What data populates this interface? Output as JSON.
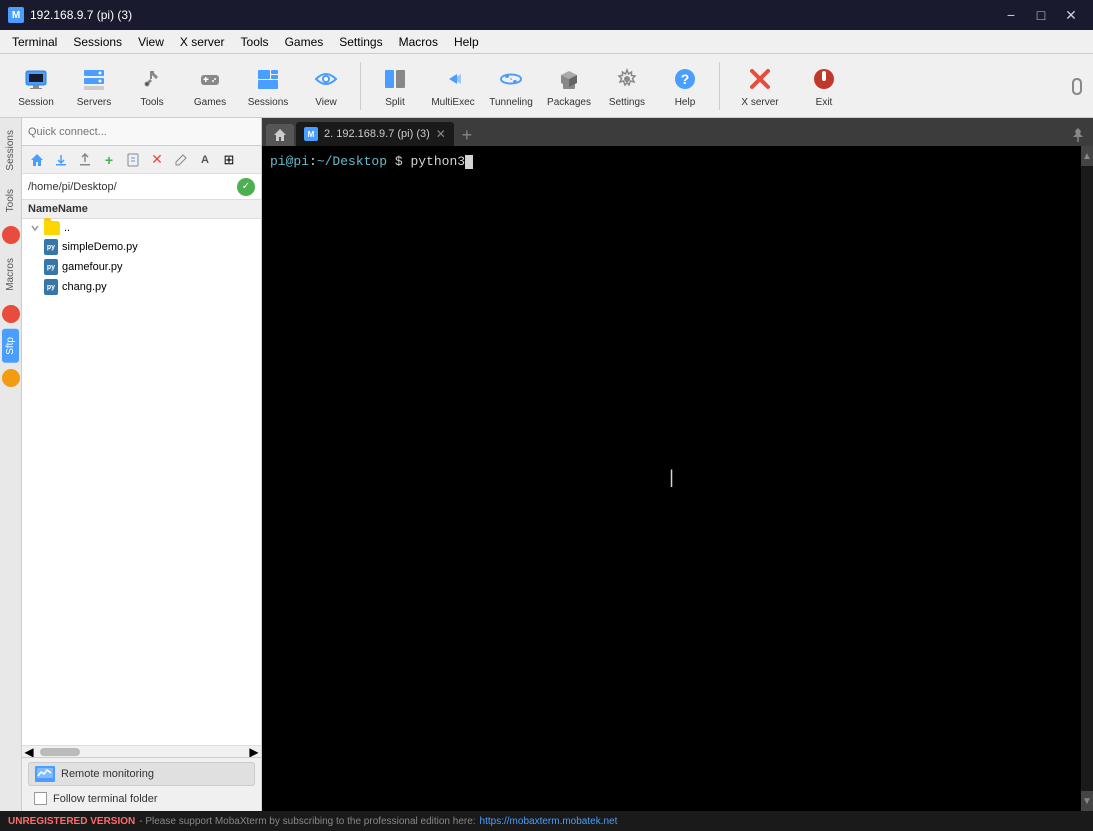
{
  "titlebar": {
    "icon": "M",
    "title": "192.168.9.7 (pi) (3)",
    "minimize": "−",
    "maximize": "□",
    "close": "✕"
  },
  "menubar": {
    "items": [
      "Terminal",
      "Sessions",
      "View",
      "X server",
      "Tools",
      "Games",
      "Settings",
      "Macros",
      "Help"
    ]
  },
  "toolbar": {
    "buttons": [
      {
        "label": "Session",
        "icon": "session"
      },
      {
        "label": "Servers",
        "icon": "servers"
      },
      {
        "label": "Tools",
        "icon": "tools"
      },
      {
        "label": "Games",
        "icon": "games"
      },
      {
        "label": "Sessions",
        "icon": "sessions"
      },
      {
        "label": "View",
        "icon": "view"
      },
      {
        "label": "Split",
        "icon": "split"
      },
      {
        "label": "MultiExec",
        "icon": "multiexec"
      },
      {
        "label": "Tunneling",
        "icon": "tunneling"
      },
      {
        "label": "Packages",
        "icon": "packages"
      },
      {
        "label": "Settings",
        "icon": "settings"
      },
      {
        "label": "Help",
        "icon": "help"
      },
      {
        "label": "X server",
        "icon": "xserver"
      },
      {
        "label": "Exit",
        "icon": "exit"
      }
    ]
  },
  "sidebar": {
    "tabs": [
      "Sessions",
      "Tools",
      "Macros",
      "Sftp"
    ]
  },
  "filepanel": {
    "quickconnect_placeholder": "Quick connect...",
    "path": "/home/pi/Desktop/",
    "columns": [
      "Name"
    ],
    "files": [
      {
        "name": "..",
        "type": "folder"
      },
      {
        "name": "simpleDemo.py",
        "type": "python"
      },
      {
        "name": "gamefour.py",
        "type": "python"
      },
      {
        "name": "chang.py",
        "type": "python"
      }
    ]
  },
  "terminal": {
    "tab_label": "2. 192.168.9.7 (pi) (3)",
    "prompt": "pi@pi:~/Desktop $ python3",
    "cursor_visible": true
  },
  "bottompanel": {
    "monitor_btn": "Remote monitoring",
    "follow_label": "Follow terminal folder",
    "follow_checked": false
  },
  "statusbar": {
    "prefix": "UNREGISTERED VERSION",
    "message": " - Please support MobaXterm by subscribing to the professional edition here: ",
    "link_text": "https://mobaxterm.mobatek.net",
    "link_url": "https://mobaxterm.mobatek.net"
  },
  "colors": {
    "accent": "#4a9eff",
    "terminal_bg": "#000000",
    "terminal_fg": "#d4d4d4",
    "status_error": "#ff6b6b"
  }
}
